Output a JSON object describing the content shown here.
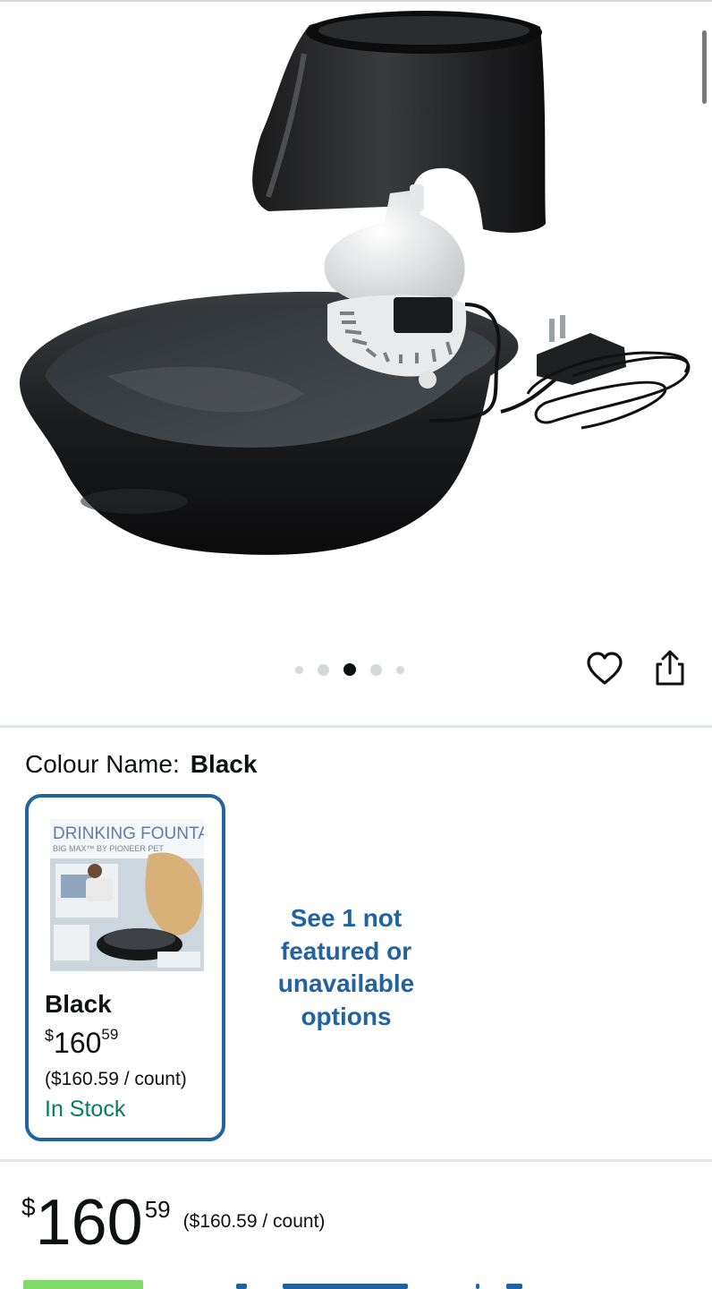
{
  "product": {
    "image_alt": "Black ceramic drinking fountain with white pump and power adapter",
    "carousel": {
      "count": 5,
      "active_index": 2
    }
  },
  "actions": {
    "wishlist_icon": "heart-icon",
    "share_icon": "share-icon"
  },
  "variation": {
    "label": "Colour Name:",
    "selected": "Black",
    "options": [
      {
        "name": "Black",
        "box_title": "DRINKING FOUNTAIN",
        "box_subtitle": "BIG MAX™ BY PIONEER PET",
        "price_currency": "$",
        "price_whole": "160",
        "price_fraction": "59",
        "unit_price": "($160.59 / count)",
        "availability": "In Stock"
      }
    ],
    "see_more": "See 1 not featured or unavailable options"
  },
  "price": {
    "currency": "$",
    "whole": "160",
    "fraction": "59",
    "unit_price": "($160.59 / count)"
  },
  "colors": {
    "link": "#2162a1",
    "in_stock": "#067d62",
    "selected_border": "#2162a1",
    "deal_badge": "#7fda69"
  }
}
